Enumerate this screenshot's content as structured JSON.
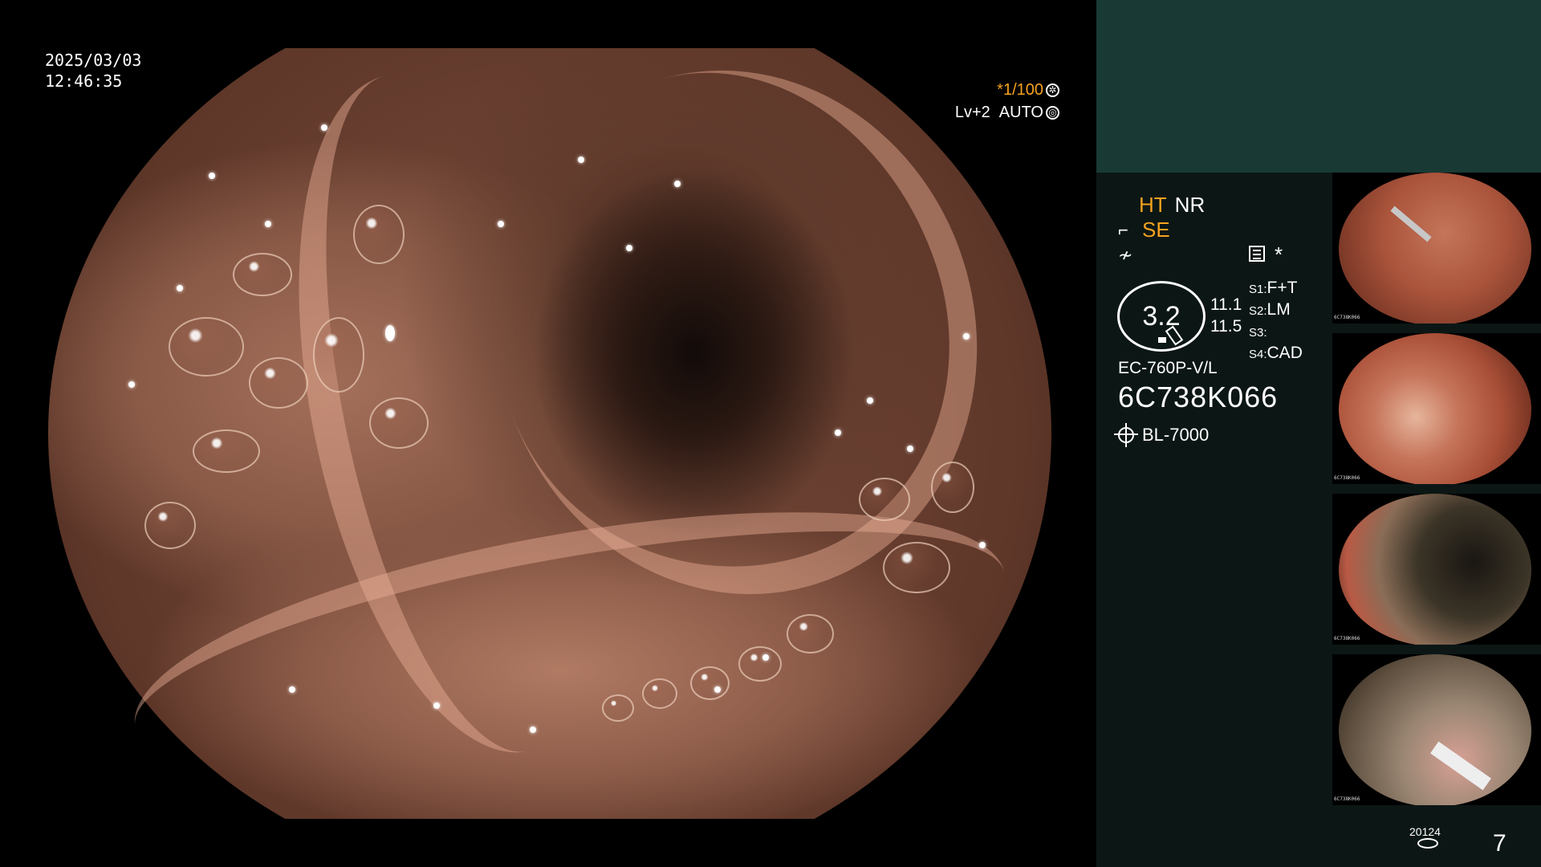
{
  "overlay": {
    "date": "2025/03/03",
    "time": "12:46:35",
    "shutter": "*1/100",
    "level": "Lv+2",
    "mode": "AUTO"
  },
  "status": {
    "ht": "HT",
    "nr": "NR",
    "se": "SE",
    "asterisk": "*",
    "capacity": "3.2",
    "value_a": "11.1",
    "value_b": "11.5",
    "scopes": [
      {
        "key": "S1:",
        "val": "F+T"
      },
      {
        "key": "S2:",
        "val": "LM"
      },
      {
        "key": "S3:",
        "val": ""
      },
      {
        "key": "S4:",
        "val": "CAD"
      }
    ],
    "model": "EC-760P-V/L",
    "serial": "6C738K066",
    "light_source": "BL-7000",
    "storage_count": "20124",
    "image_number": "7"
  },
  "thumbnails": [
    {
      "serial": "6C738K066"
    },
    {
      "serial": "6C738K066"
    },
    {
      "serial": "6C738K066"
    },
    {
      "serial": "6C738K066"
    }
  ],
  "colors": {
    "accent_orange": "#f6a21f",
    "panel_top": "#193a34",
    "panel_bottom": "#0c1715"
  }
}
